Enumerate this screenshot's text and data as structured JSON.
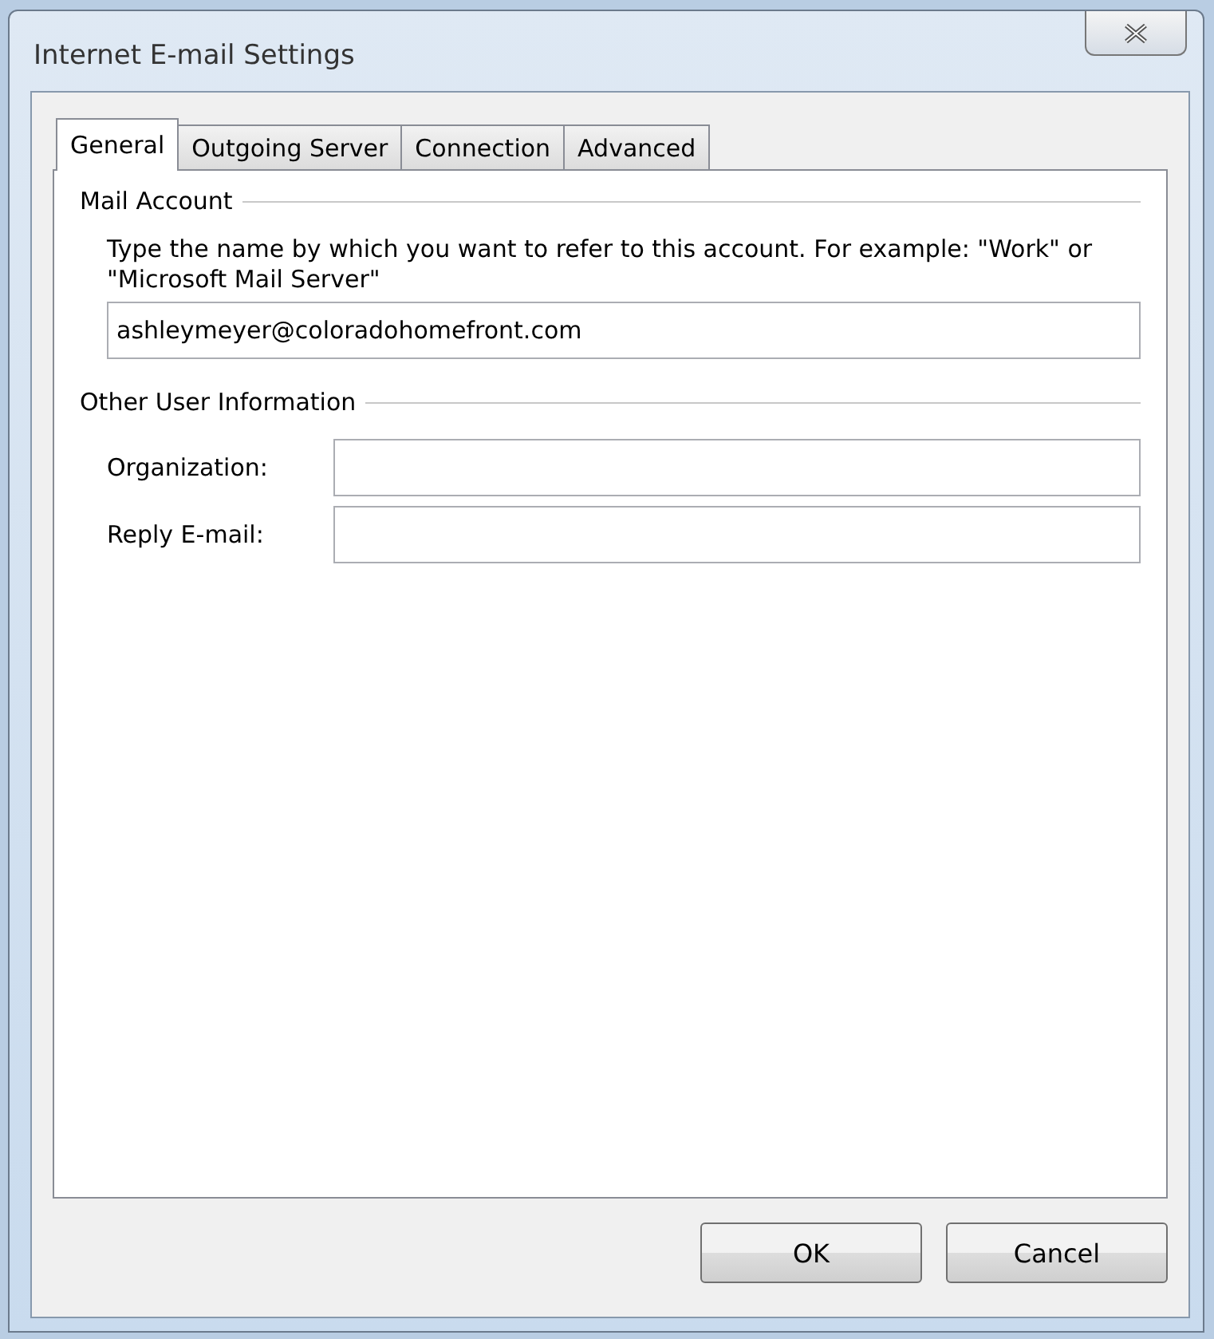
{
  "window": {
    "title": "Internet E-mail Settings"
  },
  "tabs": [
    {
      "label": "General",
      "selected": true
    },
    {
      "label": "Outgoing Server",
      "selected": false
    },
    {
      "label": "Connection",
      "selected": false
    },
    {
      "label": "Advanced",
      "selected": false
    }
  ],
  "mail_account": {
    "heading": "Mail Account",
    "description": "Type the name by which you want to refer to this account. For example: \"Work\" or \"Microsoft Mail Server\"",
    "value": "ashleymeyer@coloradohomefront.com"
  },
  "other_user_information": {
    "heading": "Other User Information",
    "fields": [
      {
        "label": "Organization:"
      },
      {
        "label": "Reply E-mail:"
      }
    ]
  },
  "buttons": [
    "OK",
    "Cancel"
  ]
}
